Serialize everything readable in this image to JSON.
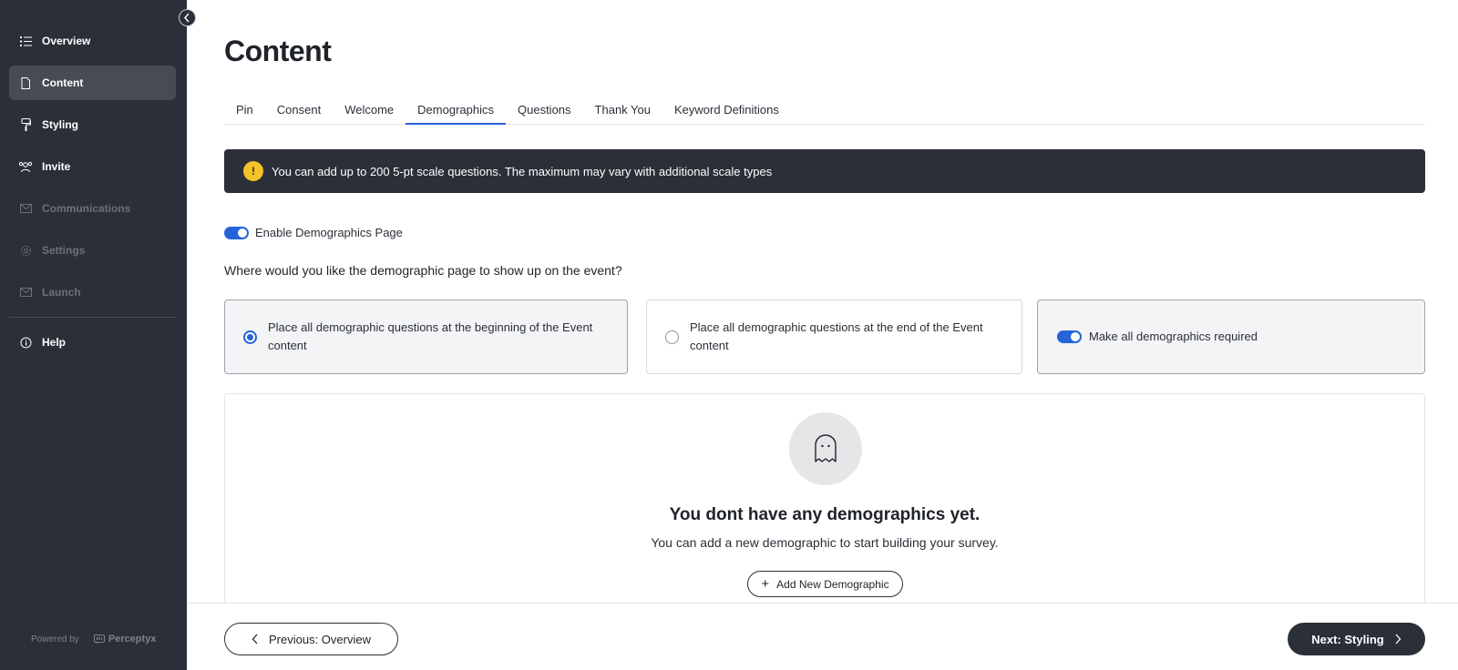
{
  "sidebar": {
    "items": [
      {
        "label": "Overview",
        "icon": "list-icon"
      },
      {
        "label": "Content",
        "icon": "document-icon"
      },
      {
        "label": "Styling",
        "icon": "paint-roller-icon"
      },
      {
        "label": "Invite",
        "icon": "users-icon"
      },
      {
        "label": "Communications",
        "icon": "envelope-icon"
      },
      {
        "label": "Settings",
        "icon": "gear-icon"
      },
      {
        "label": "Launch",
        "icon": "envelope-icon"
      },
      {
        "label": "Help",
        "icon": "info-icon"
      }
    ],
    "active_item": "Content",
    "powered_by": "Powered by",
    "brand": "Perceptyx"
  },
  "page": {
    "title": "Content"
  },
  "tabs": [
    {
      "label": "Pin"
    },
    {
      "label": "Consent"
    },
    {
      "label": "Welcome"
    },
    {
      "label": "Demographics"
    },
    {
      "label": "Questions"
    },
    {
      "label": "Thank You"
    },
    {
      "label": "Keyword Definitions"
    }
  ],
  "active_tab": "Demographics",
  "banner": {
    "icon_text": "!",
    "text": "You can add up to 200 5-pt scale questions. The maximum may vary with additional scale types"
  },
  "enable_toggle": {
    "label": "Enable Demographics Page",
    "on": true
  },
  "placement": {
    "question": "Where would you like the demographic page to show up on the event?",
    "options": [
      {
        "label": "Place all demographic questions at the beginning of the Event content",
        "selected": true
      },
      {
        "label": "Place all demographic questions at the end of the Event content",
        "selected": false
      }
    ],
    "required_toggle": {
      "label": "Make all demographics required",
      "on": true
    }
  },
  "empty_state": {
    "icon": "ghost-icon",
    "title": "You dont have any demographics yet.",
    "subtitle": "You can add a new demographic to start building your survey.",
    "button_label": "Add New Demographic"
  },
  "footer": {
    "prev_label": "Previous: Overview",
    "next_label": "Next: Styling"
  },
  "colors": {
    "sidebar_bg": "#2b2f38",
    "accent": "#2563d9",
    "warning": "#f5c228"
  }
}
